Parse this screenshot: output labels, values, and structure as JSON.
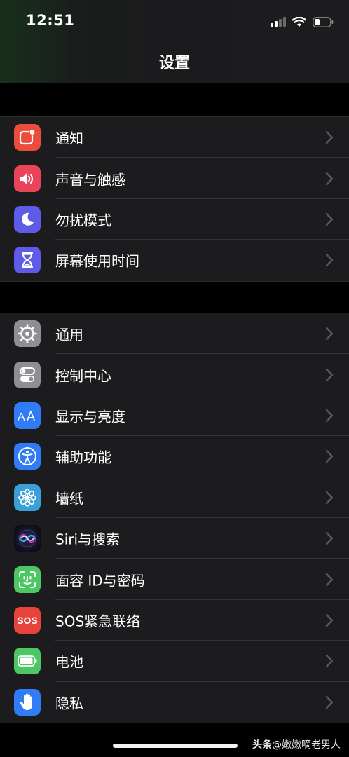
{
  "status_bar": {
    "time": "12:51",
    "icons": [
      "cellular-signal-icon",
      "wifi-icon",
      "battery-icon"
    ]
  },
  "nav": {
    "title": "设置"
  },
  "groups": [
    {
      "items": [
        {
          "label": "通知",
          "icon": "notifications-icon",
          "color": "#eb4d3d"
        },
        {
          "label": "声音与触感",
          "icon": "sound-icon",
          "color": "#eb445a"
        },
        {
          "label": "勿扰模式",
          "icon": "moon-icon",
          "color": "#5e5ce6"
        },
        {
          "label": "屏幕使用时间",
          "icon": "hourglass-icon",
          "color": "#5e5ce6"
        }
      ]
    },
    {
      "items": [
        {
          "label": "通用",
          "icon": "gear-icon",
          "color": "#8e8e93"
        },
        {
          "label": "控制中心",
          "icon": "toggles-icon",
          "color": "#8e8e93"
        },
        {
          "label": "显示与亮度",
          "icon": "text-size-icon",
          "color": "#2f7cf6"
        },
        {
          "label": "辅助功能",
          "icon": "accessibility-icon",
          "color": "#2f7cf6"
        },
        {
          "label": "墙纸",
          "icon": "flower-icon",
          "color": "#3aa0d8"
        },
        {
          "label": "Siri与搜索",
          "icon": "siri-icon",
          "color": "#1a1a2e"
        },
        {
          "label": "面容 ID与密码",
          "icon": "face-id-icon",
          "color": "#4cc764"
        },
        {
          "label": "SOS紧急联络",
          "icon": "sos-icon",
          "color": "#e5433b",
          "icon_text": "SOS"
        },
        {
          "label": "电池",
          "icon": "battery-settings-icon",
          "color": "#4cc764"
        },
        {
          "label": "隐私",
          "icon": "hand-icon",
          "color": "#2f7cf6"
        }
      ]
    }
  ],
  "watermark": {
    "brand": "头条",
    "handle": "@嫩嫩嘀老男人"
  }
}
